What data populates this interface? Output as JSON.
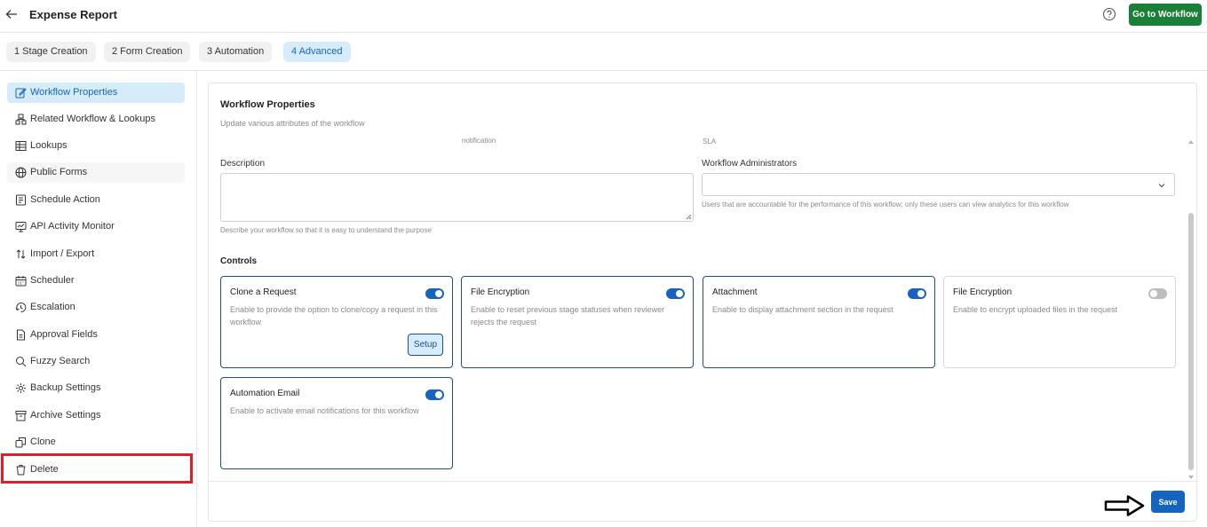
{
  "header": {
    "title": "Expense Report",
    "go_to_workflow_label": "Go to Workflow",
    "back_icon": "arrow-left-icon",
    "help_icon": "question-circle-icon"
  },
  "tabs": [
    {
      "label": "1  Stage Creation",
      "active": false
    },
    {
      "label": "2  Form Creation",
      "active": false
    },
    {
      "label": "3  Automation",
      "active": false
    },
    {
      "label": "4  Advanced",
      "active": true
    }
  ],
  "sidebar": {
    "items": [
      {
        "label": "Workflow Properties",
        "icon": "edit-icon",
        "active": true
      },
      {
        "label": "Related Workflow & Lookups",
        "icon": "hierarchy-icon",
        "active": false
      },
      {
        "label": "Lookups",
        "icon": "table-icon",
        "active": false
      },
      {
        "label": "Public Forms",
        "icon": "globe-icon",
        "active": false
      },
      {
        "label": "Schedule Action",
        "icon": "list-icon",
        "active": false
      },
      {
        "label": "API Activity Monitor",
        "icon": "monitor-icon",
        "active": false
      },
      {
        "label": "Import / Export",
        "icon": "swap-icon",
        "active": false
      },
      {
        "label": "Scheduler",
        "icon": "calendar-icon",
        "active": false
      },
      {
        "label": "Escalation",
        "icon": "escalation-icon",
        "active": false
      },
      {
        "label": "Approval Fields",
        "icon": "document-icon",
        "active": false
      },
      {
        "label": "Fuzzy Search",
        "icon": "search-icon",
        "active": false
      },
      {
        "label": "Backup Settings",
        "icon": "gear-icon",
        "active": false
      },
      {
        "label": "Archive Settings",
        "icon": "archive-icon",
        "active": false
      },
      {
        "label": "Clone",
        "icon": "copy-icon",
        "active": false
      },
      {
        "label": "Delete",
        "icon": "trash-icon",
        "active": false
      }
    ]
  },
  "panel": {
    "title": "Workflow Properties",
    "subtitle": "Update various attributes of the workflow",
    "faint_left": "notification",
    "faint_right": "SLA",
    "description": {
      "label": "Description",
      "value": "",
      "hint": "Describe your workflow so that it is easy to understand the purpose"
    },
    "administrators": {
      "label": "Workflow Administrators",
      "value": "",
      "hint": "Users that are accountable for the performance of this workflow; only these users can view analytics for this workflow"
    },
    "controls_title": "Controls",
    "controls": [
      {
        "title": "Clone a Request",
        "desc": "Enable to provide the option to clone/copy a request in this workflow",
        "enabled": true,
        "action_label": "Setup"
      },
      {
        "title": "File Encryption",
        "desc": "Enable to reset previous stage statuses when reviewer rejects the request",
        "enabled": true
      },
      {
        "title": "Attachment",
        "desc": "Enable to display attachment section in the request",
        "enabled": true
      },
      {
        "title": "File Encryption",
        "desc": "Enable to encrypt uploaded files in the request",
        "enabled": false
      },
      {
        "title": "Automation Email",
        "desc": "Enable to activate email notifications for this workflow",
        "enabled": true
      }
    ],
    "save_label": "Save"
  },
  "colors": {
    "primary": "#1565c0",
    "go_button": "#1a7f37",
    "highlight_box": "#e11d2a",
    "active_tab_bg": "#d6ecfb"
  }
}
